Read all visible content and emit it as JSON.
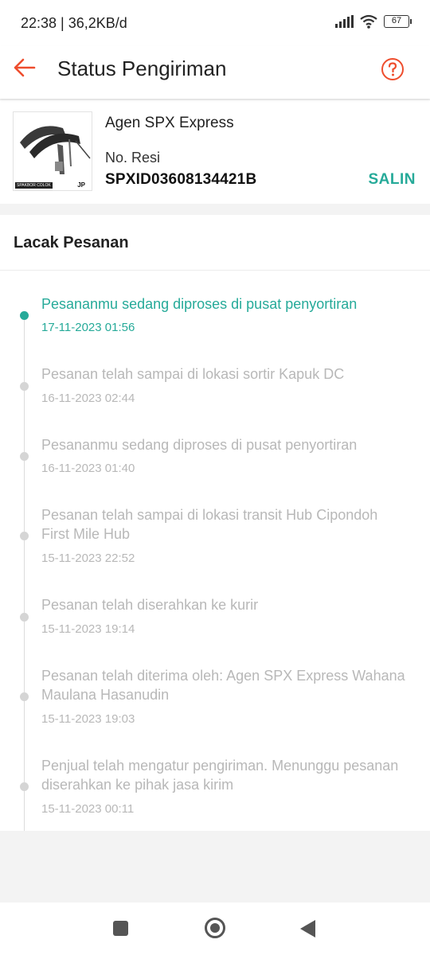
{
  "status_bar": {
    "time_speed": "22:38 | 36,2KB/d",
    "battery": "67"
  },
  "app_bar": {
    "title": "Status Pengiriman",
    "back_icon": "arrow-left-icon",
    "help_icon": "question-circle-icon",
    "accent_color": "#ee4d2d"
  },
  "shipment": {
    "courier": "Agen SPX Express",
    "resi_label": "No. Resi",
    "resi_number": "SPXID03608134421B",
    "copy_label": "SALIN",
    "thumbnail": {
      "label": "SPAKBOR COLOK",
      "mark": "JP"
    }
  },
  "tracking": {
    "header": "Lacak Pesanan",
    "active_color": "#26aa99",
    "events": [
      {
        "text": "Pesananmu sedang diproses di pusat penyortiran",
        "time": "17-11-2023 01:56",
        "active": true
      },
      {
        "text": "Pesanan telah sampai di lokasi sortir Kapuk DC",
        "time": "16-11-2023 02:44",
        "active": false
      },
      {
        "text": "Pesananmu sedang diproses di pusat penyortiran",
        "time": "16-11-2023 01:40",
        "active": false
      },
      {
        "text": "Pesanan telah sampai di lokasi transit Hub Cipondoh First Mile Hub",
        "time": "15-11-2023 22:52",
        "active": false
      },
      {
        "text": "Pesanan telah diserahkan ke kurir",
        "time": "15-11-2023 19:14",
        "active": false
      },
      {
        "text": "Pesanan telah diterima oleh: Agen SPX Express Wahana Maulana Hasanudin",
        "time": "15-11-2023 19:03",
        "active": false
      },
      {
        "text": "Penjual telah mengatur pengiriman. Menunggu pesanan diserahkan ke pihak jasa kirim",
        "time": "15-11-2023 00:11",
        "active": false
      }
    ]
  },
  "nav_bar": {
    "recents_icon": "square-icon",
    "home_icon": "circle-home-icon",
    "back_icon": "triangle-back-icon"
  }
}
